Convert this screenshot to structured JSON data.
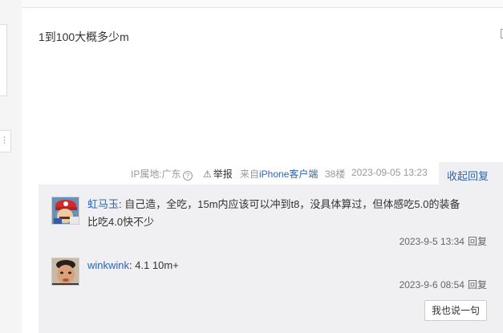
{
  "post": {
    "text": "1到100大概多少m"
  },
  "meta": {
    "ip_location": "IP属地:广东",
    "help_icon": "?",
    "report_icon": "warning-triangle-icon",
    "report_label": "举报",
    "source_prefix": "来自",
    "source_device": "iPhone客户端",
    "floor": "38楼",
    "datetime": "2023-09-05 13:23",
    "collapse_label": "收起回复"
  },
  "replies": [
    {
      "user": "虹马玉",
      "separator": ":",
      "content_line1": "自己造，全吃，15m内应该可以冲到t8，没具体算过，但体感吃5.0的装备",
      "content_line2": "比吃4.0快不少",
      "time": "2023-9-5 13:34",
      "reply_label": "回复",
      "avatar_icon": "avatar-mario-icon"
    },
    {
      "user": "winkwink",
      "separator": ":",
      "content_line1": "4.1 10m+",
      "time": "2023-9-6 08:54",
      "reply_label": "回复",
      "avatar_icon": "avatar-face-icon"
    }
  ],
  "reply_box": {
    "say_button_label": "我也说一句"
  },
  "colors": {
    "link_blue": "#2d64b3",
    "reply_bg": "#f0f0f2",
    "meta_gray": "#999999"
  }
}
